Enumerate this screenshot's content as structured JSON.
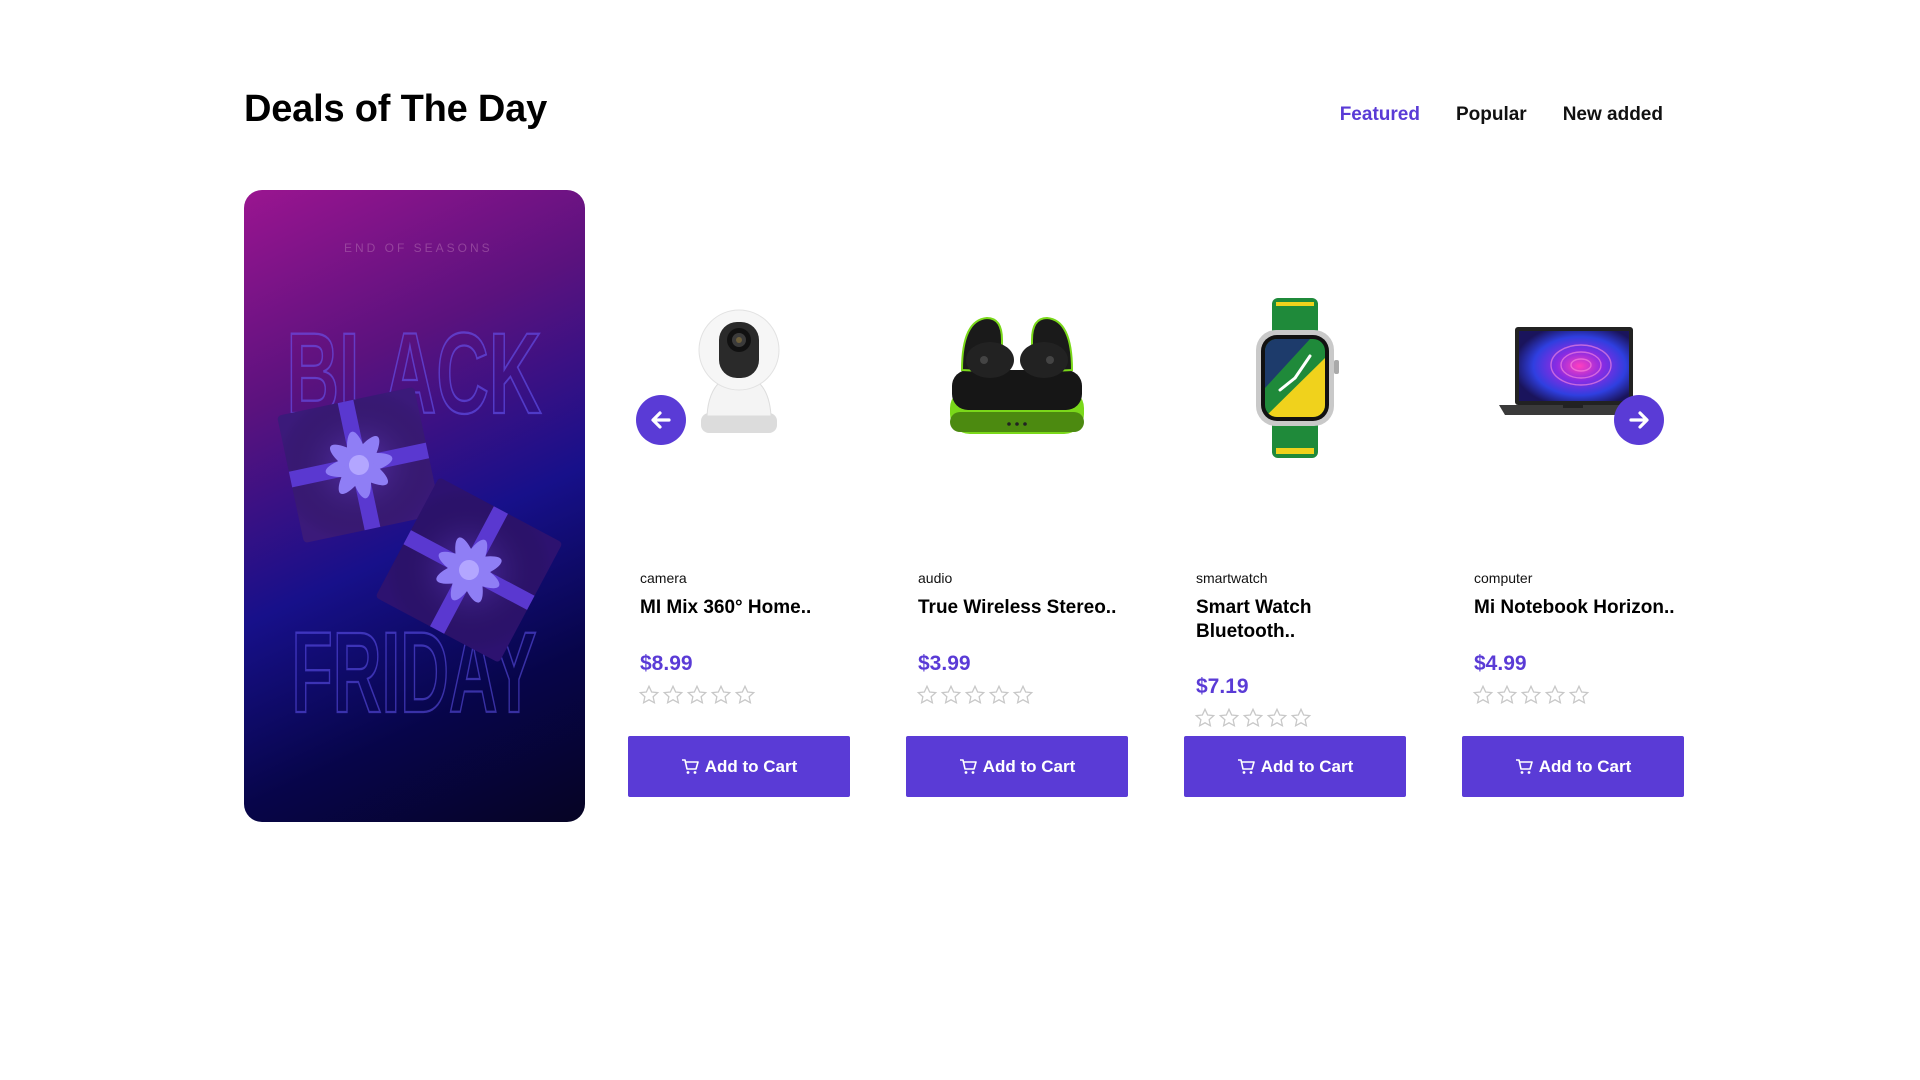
{
  "section": {
    "title": "Deals of The Day",
    "tabs": [
      {
        "label": "Featured",
        "active": true
      },
      {
        "label": "Popular",
        "active": false
      },
      {
        "label": "New added",
        "active": false
      }
    ]
  },
  "banner": {
    "tagline": "END OF SEASONS",
    "line1": "BLACK",
    "line2": "FRIDAY"
  },
  "products": [
    {
      "category": "camera",
      "name": "MI Mix 360° Home..",
      "price": "$8.99",
      "rating": 0,
      "icon": "security-camera-icon",
      "button_label": "Add to Cart"
    },
    {
      "category": "audio",
      "name": "True Wireless Stereo..",
      "price": "$3.99",
      "rating": 0,
      "icon": "earbuds-icon",
      "button_label": "Add to Cart"
    },
    {
      "category": "smartwatch",
      "name": "Smart Watch Bluetooth..",
      "price": "$7.19",
      "rating": 0,
      "icon": "smartwatch-icon",
      "button_label": "Add to Cart"
    },
    {
      "category": "computer",
      "name": "Mi Notebook Horizon..",
      "price": "$4.99",
      "rating": 0,
      "icon": "laptop-icon",
      "button_label": "Add to Cart"
    }
  ],
  "colors": {
    "accent": "#5a3bd6",
    "text": "#111111",
    "star_outline": "#c8c8c8"
  }
}
